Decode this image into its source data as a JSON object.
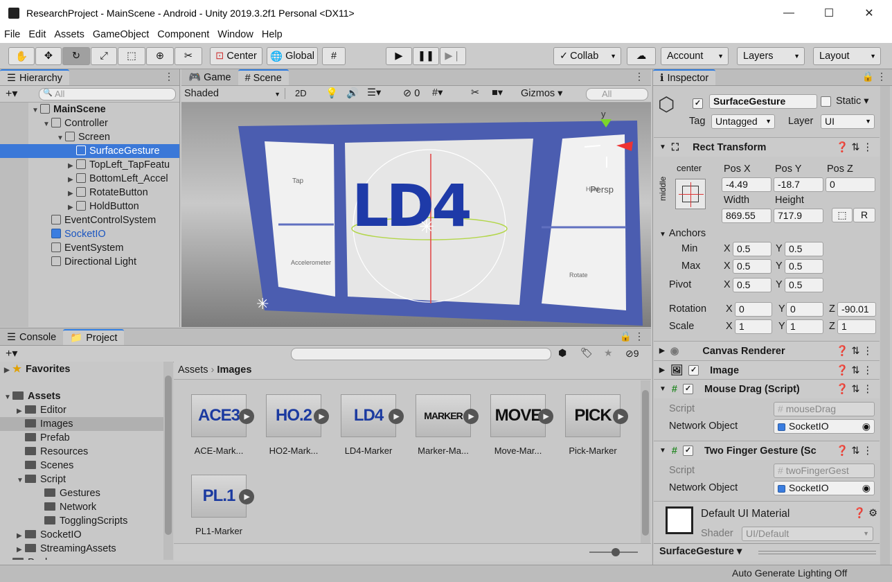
{
  "window": {
    "title": "ResearchProject - MainScene - Android - Unity 2019.3.2f1 Personal <DX11>",
    "minimize": "—",
    "maximize": "☐",
    "close": "✕"
  },
  "menu": [
    "File",
    "Edit",
    "Assets",
    "GameObject",
    "Component",
    "Window",
    "Help"
  ],
  "toolbar": {
    "center": "Center",
    "global": "Global",
    "collab": "Collab",
    "account": "Account",
    "layers": "Layers",
    "layout": "Layout"
  },
  "hierarchy": {
    "tab": "Hierarchy",
    "search_placeholder": "All",
    "items": [
      {
        "label": "MainScene",
        "depth": 0,
        "bold": true
      },
      {
        "label": "Controller",
        "depth": 1
      },
      {
        "label": "Screen",
        "depth": 2
      },
      {
        "label": "SurfaceGesture",
        "depth": 3,
        "selected": true
      },
      {
        "label": "TopLeft_TapFeatu",
        "depth": 3
      },
      {
        "label": "BottomLeft_Accel",
        "depth": 3
      },
      {
        "label": "RotateButton",
        "depth": 3
      },
      {
        "label": "HoldButton",
        "depth": 3
      },
      {
        "label": "EventControlSystem",
        "depth": 1
      },
      {
        "label": "SocketIO",
        "depth": 1,
        "blue": true
      },
      {
        "label": "EventSystem",
        "depth": 1
      },
      {
        "label": "Directional Light",
        "depth": 1
      }
    ]
  },
  "scene": {
    "tab_game": "Game",
    "tab_scene": "Scene",
    "shading": "Shaded",
    "mode2d": "2D",
    "fx_count": "0",
    "gizmos": "Gizmos",
    "search_placeholder": "All",
    "axis_y": "y",
    "persp": "Persp",
    "marker_text": "LD4",
    "label_tap": "Tap",
    "label_accel": "Accelerometer",
    "label_hold": "Hold",
    "label_rotate": "Rotate"
  },
  "inspector": {
    "tab": "Inspector",
    "name": "SurfaceGesture",
    "static": "Static",
    "tag_label": "Tag",
    "tag": "Untagged",
    "layer_label": "Layer",
    "layer": "UI",
    "rect_transform": "Rect Transform",
    "anchor_h": "center",
    "anchor_v": "middle",
    "posx_label": "Pos X",
    "posy_label": "Pos Y",
    "posz_label": "Pos Z",
    "posx": "-4.49",
    "posy": "-18.7",
    "posz": "0",
    "width_label": "Width",
    "height_label": "Height",
    "width": "869.55",
    "height": "717.9",
    "r_btn": "R",
    "anchors": "Anchors",
    "min": "Min",
    "max": "Max",
    "pivot": "Pivot",
    "x": "X",
    "y": "Y",
    "z": "Z",
    "min_x": "0.5",
    "min_y": "0.5",
    "max_x": "0.5",
    "max_y": "0.5",
    "pivot_x": "0.5",
    "pivot_y": "0.5",
    "rotation": "Rotation",
    "rot_x": "0",
    "rot_y": "0",
    "rot_z": "-90.01",
    "scale": "Scale",
    "sc_x": "1",
    "sc_y": "1",
    "sc_z": "1",
    "canvas_renderer": "Canvas Renderer",
    "image": "Image",
    "mouse_drag": "Mouse Drag (Script)",
    "script_label": "Script",
    "mouse_drag_script": "mouseDrag",
    "network_object": "Network Object",
    "socketio": "SocketIO",
    "two_finger": "Two Finger Gesture (Sc",
    "two_finger_script": "twoFingerGest",
    "material": "Default UI Material",
    "shader_label": "Shader",
    "shader": "UI/Default",
    "footer": "SurfaceGesture"
  },
  "project": {
    "tab_console": "Console",
    "tab_project": "Project",
    "favorites": "Favorites",
    "count": "9",
    "tree": [
      {
        "label": "Assets",
        "depth": 0,
        "bold": true
      },
      {
        "label": "Editor",
        "depth": 1
      },
      {
        "label": "Images",
        "depth": 1,
        "selected": true
      },
      {
        "label": "Prefab",
        "depth": 1
      },
      {
        "label": "Resources",
        "depth": 1
      },
      {
        "label": "Scenes",
        "depth": 1
      },
      {
        "label": "Script",
        "depth": 1
      },
      {
        "label": "Gestures",
        "depth": 2
      },
      {
        "label": "Network",
        "depth": 2
      },
      {
        "label": "TogglingScripts",
        "depth": 2
      },
      {
        "label": "SocketIO",
        "depth": 1
      },
      {
        "label": "StreamingAssets",
        "depth": 1
      },
      {
        "label": "Packages",
        "depth": 0
      }
    ],
    "breadcrumb": [
      "Assets",
      "Images"
    ],
    "assets": [
      {
        "name": "ACE-Mark...",
        "glyph": "ACE3"
      },
      {
        "name": "HO2-Mark...",
        "glyph": "HO.2"
      },
      {
        "name": "LD4-Marker",
        "glyph": "LD4"
      },
      {
        "name": "Marker-Ma...",
        "glyph": "MARKER"
      },
      {
        "name": "Move-Mar...",
        "glyph": "MOVE"
      },
      {
        "name": "Pick-Marker",
        "glyph": "PICK"
      },
      {
        "name": "PL1-Marker",
        "glyph": "PL.1"
      }
    ]
  },
  "status": "Auto Generate Lighting Off"
}
